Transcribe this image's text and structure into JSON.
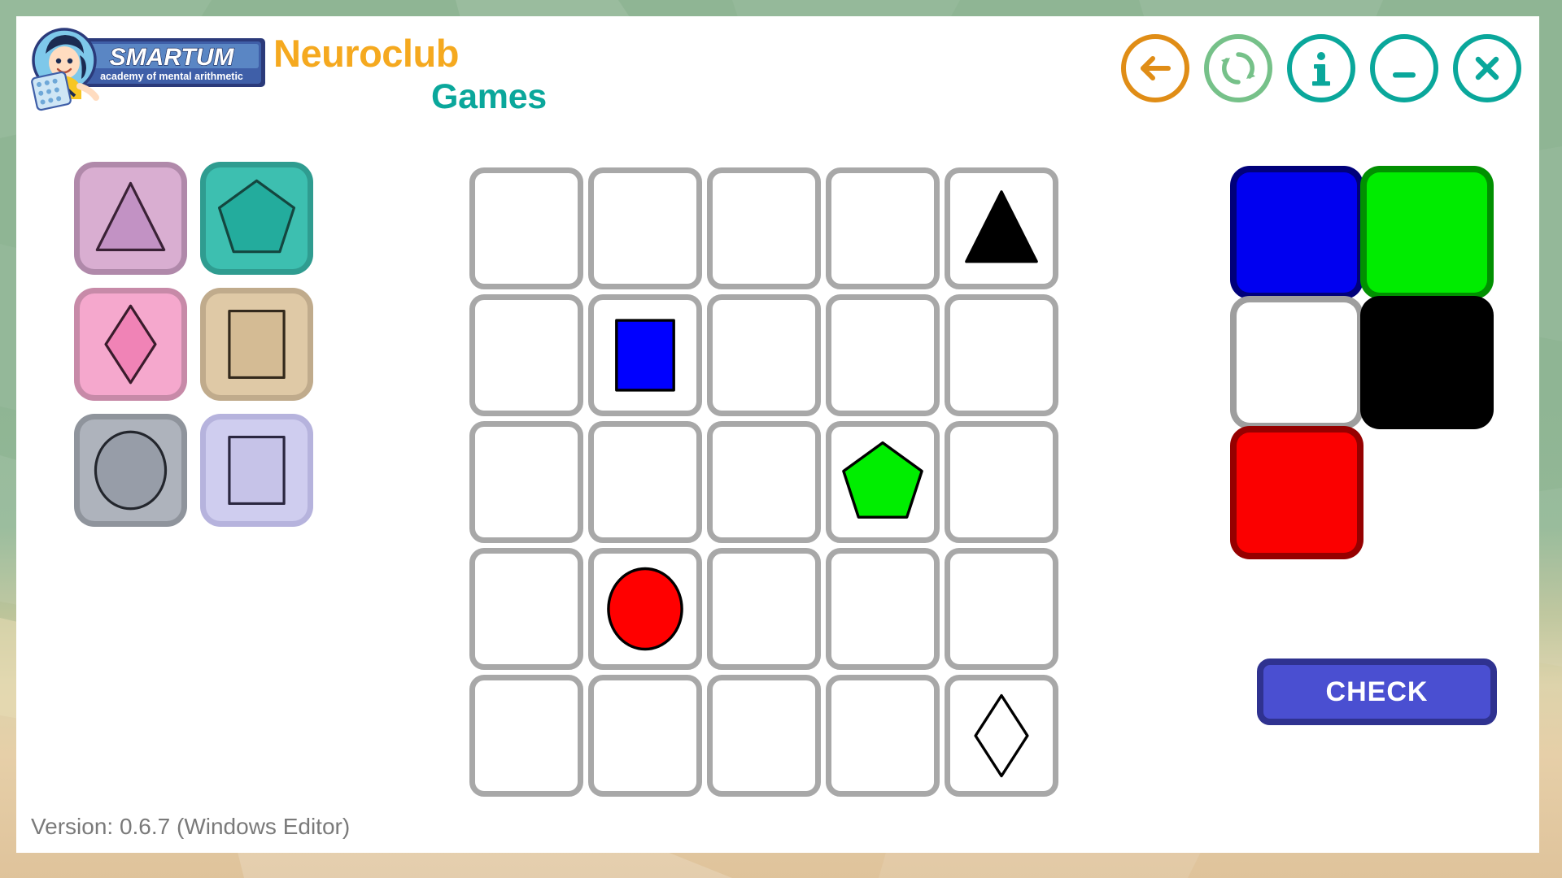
{
  "app": {
    "brand_title": "Neuroclub",
    "page_subtitle": "Games",
    "version_text": "Version: 0.6.7 (Windows Editor)",
    "logo": {
      "wordmark": "SMARTUM",
      "tagline": "academy of mental arithmetic"
    }
  },
  "window_buttons": [
    {
      "name": "back-button",
      "icon": "arrow-left-icon",
      "color": "#e08d16"
    },
    {
      "name": "reset-button",
      "icon": "refresh-icon",
      "color": "#76c189"
    },
    {
      "name": "info-button",
      "icon": "info-icon",
      "color": "#0aa79b"
    },
    {
      "name": "minimize-button",
      "icon": "minimize-icon",
      "color": "#0aa79b"
    },
    {
      "name": "close-button",
      "icon": "close-icon",
      "color": "#0aa79b"
    }
  ],
  "shape_palette": {
    "rows": 3,
    "cols": 2,
    "tiles": [
      {
        "shape": "triangle",
        "tile_bg": "#d9aed1",
        "tile_border": "#b089aa",
        "fill": "#c292c4",
        "stroke": "#3a2236"
      },
      {
        "shape": "pentagon",
        "tile_bg": "#3dbfb0",
        "tile_border": "#2f9c90",
        "fill": "#23ac9d",
        "stroke": "#14463f"
      },
      {
        "shape": "diamond",
        "tile_bg": "#f5a8cd",
        "tile_border": "#c78aa8",
        "fill": "#f083b6",
        "stroke": "#3a1c2c"
      },
      {
        "shape": "square",
        "tile_bg": "#dfc9a6",
        "tile_border": "#c0ab8c",
        "fill": "#d4bb94",
        "stroke": "#33291c"
      },
      {
        "shape": "circle",
        "tile_bg": "#aeb3bc",
        "tile_border": "#8f949c",
        "fill": "#979da8",
        "stroke": "#23262d"
      },
      {
        "shape": "square",
        "tile_bg": "#cfcdef",
        "tile_border": "#b6b3dd",
        "fill": "#c6c3e8",
        "stroke": "#2b2740"
      }
    ]
  },
  "play_grid": {
    "rows": 5,
    "cols": 5,
    "cell_border": "#a8a8a8",
    "cells": [
      [
        null,
        null,
        null,
        null,
        {
          "shape": "triangle",
          "fill": "#000000",
          "stroke": "#000000"
        }
      ],
      [
        null,
        {
          "shape": "square",
          "fill": "#0000ff",
          "stroke": "#000000"
        },
        null,
        null,
        null
      ],
      [
        null,
        null,
        null,
        {
          "shape": "pentagon",
          "fill": "#00ee00",
          "stroke": "#000000"
        },
        null
      ],
      [
        null,
        {
          "shape": "circle",
          "fill": "#ff0000",
          "stroke": "#000000"
        },
        null,
        null,
        null
      ],
      [
        null,
        null,
        null,
        null,
        {
          "shape": "diamond",
          "fill": "#ffffff",
          "stroke": "#000000"
        }
      ]
    ]
  },
  "color_palette": {
    "rows": 3,
    "cols": 2,
    "tiles": [
      {
        "label": "blue",
        "fill": "#0000f0",
        "border": "#00007a"
      },
      {
        "label": "green",
        "fill": "#00ec00",
        "border": "#019001"
      },
      {
        "label": "white",
        "fill": "#ffffff",
        "border": "#9e9e9e"
      },
      {
        "label": "black",
        "fill": "#000000",
        "border": "#000000"
      },
      {
        "label": "red",
        "fill": "#fb0000",
        "border": "#960000"
      },
      {
        "label": "",
        "fill": "",
        "border": ""
      }
    ]
  },
  "check_button": {
    "label": "CHECK",
    "fill": "#4a4fd1",
    "border": "#2f3290"
  }
}
